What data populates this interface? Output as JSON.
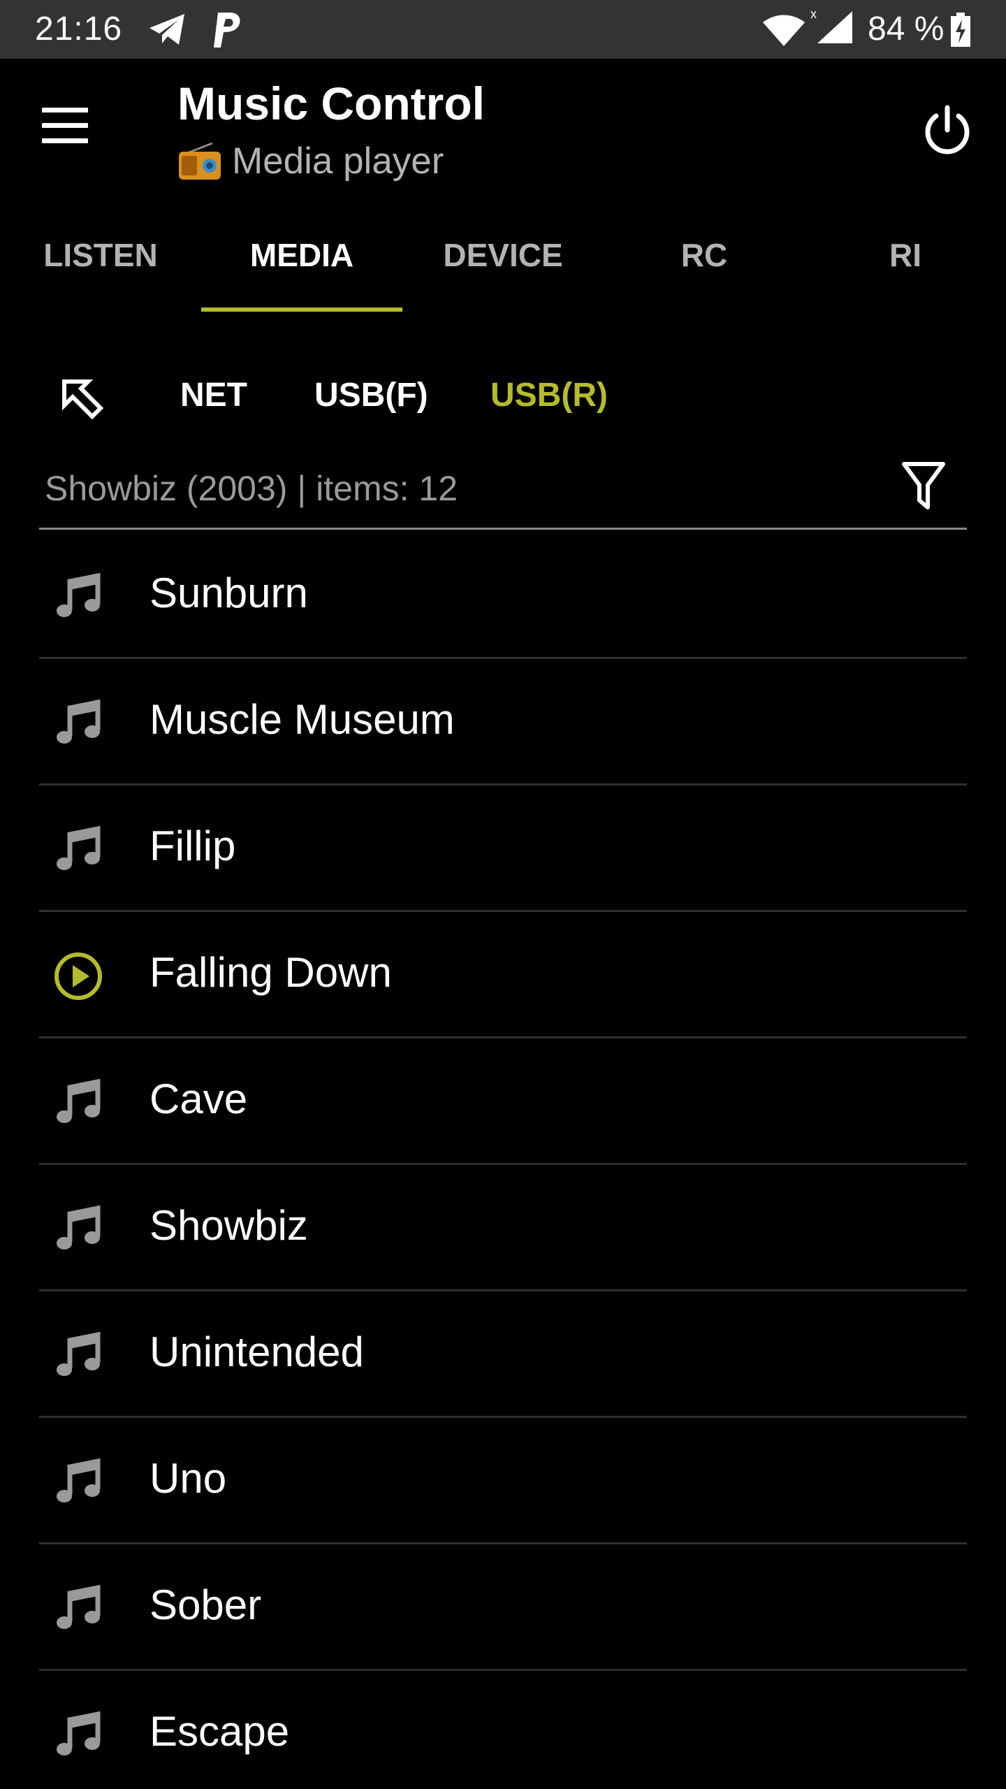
{
  "status_bar": {
    "time": "21:16",
    "battery_percent": "84 %",
    "icons": [
      "telegram-icon",
      "p-icon",
      "wifi-icon",
      "signal-icon",
      "battery-charging-icon"
    ]
  },
  "app_bar": {
    "title": "Music Control",
    "subtitle": "Media player",
    "subtitle_icon": "radio-icon"
  },
  "tabs": [
    {
      "label": "LISTEN",
      "active": false
    },
    {
      "label": "MEDIA",
      "active": true
    },
    {
      "label": "DEVICE",
      "active": false
    },
    {
      "label": "RC",
      "active": false
    },
    {
      "label": "RI",
      "active": false
    }
  ],
  "sources": [
    {
      "label": "NET",
      "active": false
    },
    {
      "label": "USB(F)",
      "active": false
    },
    {
      "label": "USB(R)",
      "active": true
    }
  ],
  "path": {
    "text": "Showbiz (2003) | items: 12"
  },
  "tracks": [
    {
      "title": "Sunburn",
      "icon": "music-note-icon"
    },
    {
      "title": "Muscle Museum",
      "icon": "music-note-icon"
    },
    {
      "title": "Fillip",
      "icon": "music-note-icon"
    },
    {
      "title": "Falling Down",
      "icon": "play-circle-icon"
    },
    {
      "title": "Cave",
      "icon": "music-note-icon"
    },
    {
      "title": "Showbiz",
      "icon": "music-note-icon"
    },
    {
      "title": "Unintended",
      "icon": "music-note-icon"
    },
    {
      "title": "Uno",
      "icon": "music-note-icon"
    },
    {
      "title": "Sober",
      "icon": "music-note-icon"
    },
    {
      "title": "Escape",
      "icon": "music-note-icon"
    }
  ],
  "colors": {
    "accent": "#b5bc2c",
    "background": "#000000",
    "status_bar": "#333333",
    "inactive_text": "#b3b3b3",
    "note_icon": "#9a9a9a"
  }
}
